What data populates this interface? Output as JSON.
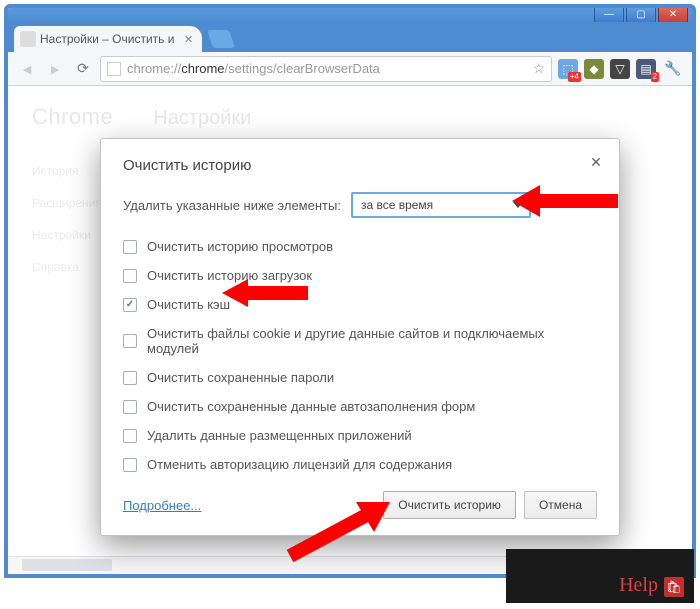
{
  "tab": {
    "title": "Настройки – Очистить и"
  },
  "omnibox": {
    "protocol": "chrome://",
    "host": "chrome",
    "path": "/settings/clearBrowserData"
  },
  "page": {
    "brand": "Chrome",
    "title": "Настройки",
    "sidebar": [
      "История",
      "Расширения",
      "Настройки",
      "",
      "Справка"
    ]
  },
  "dialog": {
    "title": "Очистить историю",
    "prompt": "Удалить указанные ниже элементы:",
    "range_selected": "за все время",
    "items": [
      {
        "label": "Очистить историю просмотров",
        "checked": false
      },
      {
        "label": "Очистить историю загрузок",
        "checked": false
      },
      {
        "label": "Очистить кэш",
        "checked": true
      },
      {
        "label": "Очистить файлы cookie и другие данные сайтов и подключаемых модулей",
        "checked": false
      },
      {
        "label": "Очистить сохраненные пароли",
        "checked": false
      },
      {
        "label": "Очистить сохраненные данные автозаполнения форм",
        "checked": false
      },
      {
        "label": "Удалить данные размещенных приложений",
        "checked": false
      },
      {
        "label": "Отменить авторизацию лицензий для содержания",
        "checked": false
      }
    ],
    "more": "Подробнее...",
    "ok": "Очистить историю",
    "cancel": "Отмена"
  },
  "help_badge": "Help"
}
